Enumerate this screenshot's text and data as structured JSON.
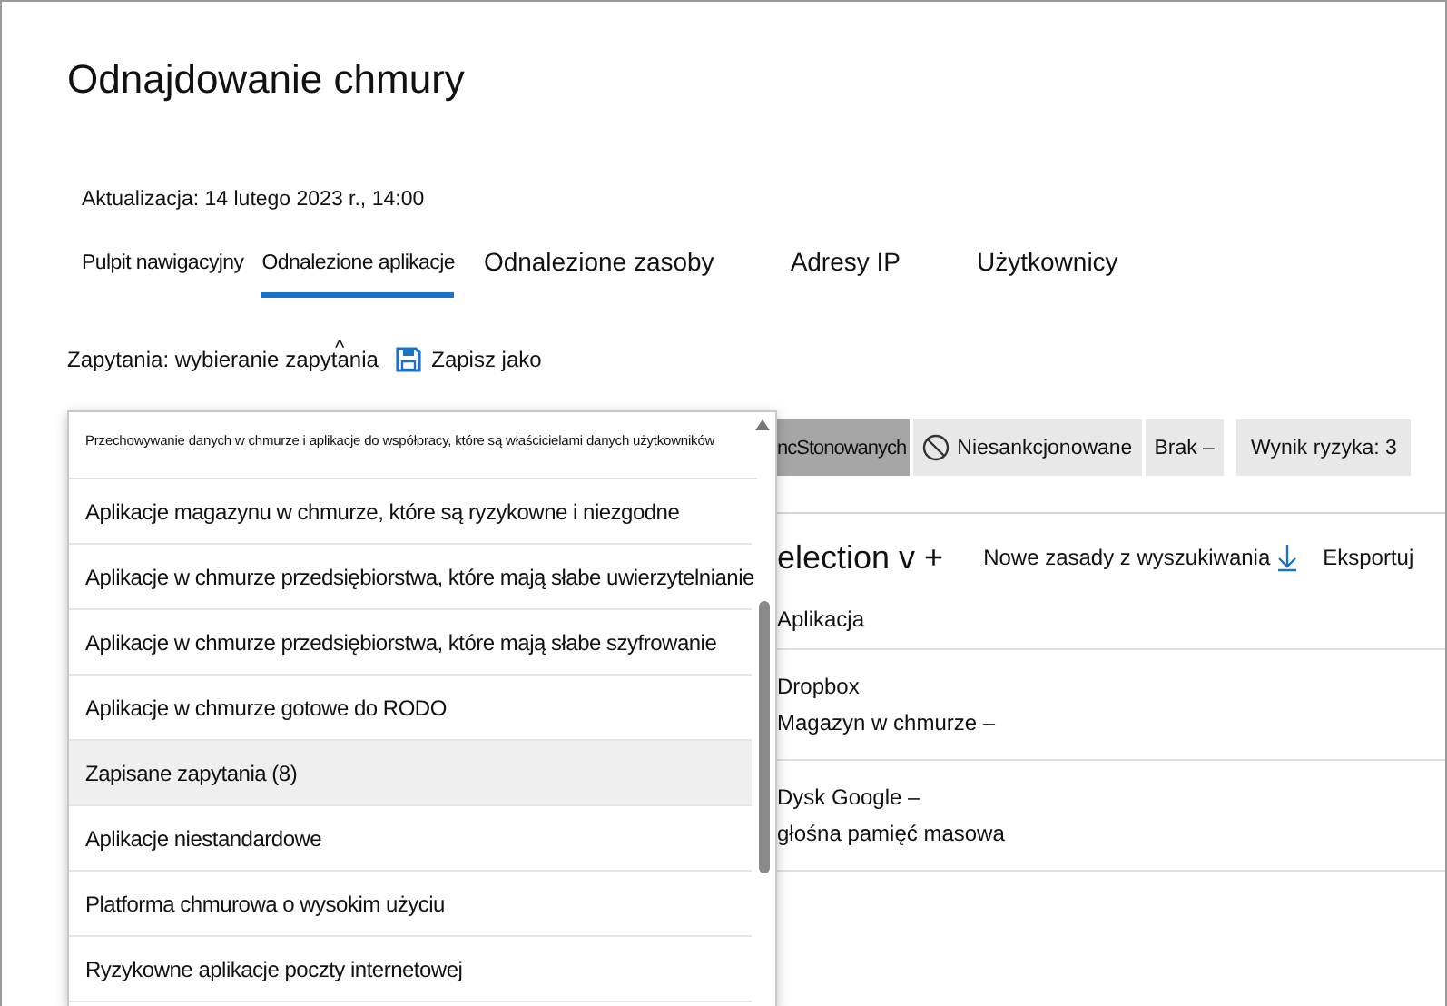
{
  "title": "Odnajdowanie chmury",
  "updated": "Aktualizacja: 14 lutego 2023 r., 14:00",
  "tabs": [
    {
      "label": "Pulpit nawigacyjny",
      "selected": false,
      "kind": "compact"
    },
    {
      "label": "Odnalezione aplikacje",
      "selected": true,
      "kind": "compact"
    },
    {
      "label": "Odnalezione zasoby",
      "selected": false,
      "kind": "regular"
    },
    {
      "label": "Adresy IP",
      "selected": false,
      "kind": "regular"
    },
    {
      "label": "Użytkownicy",
      "selected": false,
      "kind": "regular"
    }
  ],
  "query": {
    "label": "Zapytania: wybieranie zapytania",
    "caret": "^",
    "save": "Zapisz jako"
  },
  "dropdown": {
    "header": "Przechowywanie danych w chmurze i aplikacje do współpracy, które są właścicielami danych użytkowników",
    "items": [
      {
        "label": "Aplikacje magazynu w chmurze, które są ryzykowne i niezgodne",
        "selected": false
      },
      {
        "label": "Aplikacje w chmurze przedsiębiorstwa, które mają słabe uwierzytelnianie",
        "selected": false
      },
      {
        "label": "Aplikacje w chmurze przedsiębiorstwa, które mają słabe szyfrowanie",
        "selected": false
      },
      {
        "label": "Aplikacje w chmurze gotowe do RODO",
        "selected": false
      },
      {
        "label": "Zapisane zapytania (8)",
        "selected": true
      },
      {
        "label": "Aplikacje niestandardowe",
        "selected": false
      },
      {
        "label": "Platforma chmurowa o wysokim użyciu",
        "selected": false
      },
      {
        "label": "Ryzykowne aplikacje poczty internetowej",
        "selected": false
      }
    ]
  },
  "filters": [
    {
      "label": "ncStonowanych",
      "selected": true,
      "kind": "plain"
    },
    {
      "label": "Niesankcjonowane",
      "selected": false,
      "kind": "ban"
    },
    {
      "label": "Brak –",
      "selected": false,
      "kind": "plain"
    },
    {
      "label": "Wynik ryzyka: 3",
      "selected": false,
      "kind": "plain"
    }
  ],
  "toolbar": {
    "heading": "election v +",
    "new_policy": "Nowe zasady z wyszukiwania",
    "export": "Eksportuj"
  },
  "table": {
    "columns": [
      "Aplikacja"
    ],
    "rows": [
      {
        "name": "Dropbox",
        "category": "Magazyn w chmurze –"
      },
      {
        "name": "Dysk Google –",
        "category": "głośna pamięć masowa"
      }
    ]
  }
}
